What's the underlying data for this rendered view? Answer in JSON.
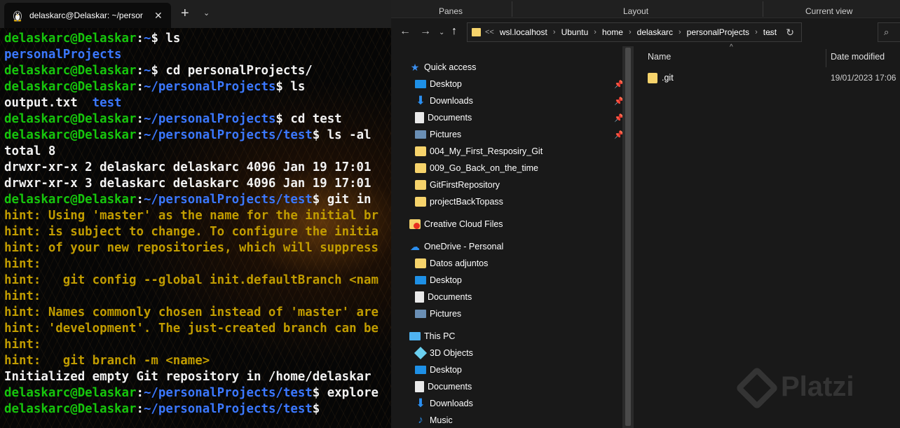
{
  "terminal": {
    "tab_title": "delaskarc@Delaskar: ~/persor",
    "icons": {
      "tab": "linux-tux-icon",
      "close": "close-icon",
      "new_tab": "plus-icon",
      "menu": "chevron-down-icon"
    },
    "lines": [
      [
        {
          "c": "pu",
          "t": "delaskarc@Delaskar"
        },
        {
          "c": "pw",
          "t": ":"
        },
        {
          "c": "pp",
          "t": "~"
        },
        {
          "c": "pw",
          "t": "$ ls"
        }
      ],
      [
        {
          "c": "dir",
          "t": "personalProjects"
        }
      ],
      [
        {
          "c": "pu",
          "t": "delaskarc@Delaskar"
        },
        {
          "c": "pw",
          "t": ":"
        },
        {
          "c": "pp",
          "t": "~"
        },
        {
          "c": "pw",
          "t": "$ cd personalProjects/"
        }
      ],
      [
        {
          "c": "pu",
          "t": "delaskarc@Delaskar"
        },
        {
          "c": "pw",
          "t": ":"
        },
        {
          "c": "pp",
          "t": "~/personalProjects"
        },
        {
          "c": "pw",
          "t": "$ ls"
        }
      ],
      [
        {
          "c": "cmd",
          "t": "output.txt  "
        },
        {
          "c": "dir",
          "t": "test"
        }
      ],
      [
        {
          "c": "pu",
          "t": "delaskarc@Delaskar"
        },
        {
          "c": "pw",
          "t": ":"
        },
        {
          "c": "pp",
          "t": "~/personalProjects"
        },
        {
          "c": "pw",
          "t": "$ cd test"
        }
      ],
      [
        {
          "c": "pu",
          "t": "delaskarc@Delaskar"
        },
        {
          "c": "pw",
          "t": ":"
        },
        {
          "c": "pp",
          "t": "~/personalProjects/test"
        },
        {
          "c": "pw",
          "t": "$ ls -al"
        }
      ],
      [
        {
          "c": "cmd",
          "t": "total 8"
        }
      ],
      [
        {
          "c": "cmd",
          "t": "drwxr-xr-x 2 delaskarc delaskarc 4096 Jan 19 17:01"
        }
      ],
      [
        {
          "c": "cmd",
          "t": "drwxr-xr-x 3 delaskarc delaskarc 4096 Jan 19 17:01"
        }
      ],
      [
        {
          "c": "pu",
          "t": "delaskarc@Delaskar"
        },
        {
          "c": "pw",
          "t": ":"
        },
        {
          "c": "pp",
          "t": "~/personalProjects/test"
        },
        {
          "c": "pw",
          "t": "$ git in"
        }
      ],
      [
        {
          "c": "hint",
          "t": "hint: Using 'master' as the name for the initial br"
        }
      ],
      [
        {
          "c": "hint",
          "t": "hint: is subject to change. To configure the initia"
        }
      ],
      [
        {
          "c": "hint",
          "t": "hint: of your new repositories, which will suppress"
        }
      ],
      [
        {
          "c": "hint",
          "t": "hint:"
        }
      ],
      [
        {
          "c": "hint",
          "t": "hint:   git config --global init.defaultBranch <nam"
        }
      ],
      [
        {
          "c": "hint",
          "t": "hint:"
        }
      ],
      [
        {
          "c": "hint",
          "t": "hint: Names commonly chosen instead of 'master' are"
        }
      ],
      [
        {
          "c": "hint",
          "t": "hint: 'development'. The just-created branch can be"
        }
      ],
      [
        {
          "c": "hint",
          "t": "hint:"
        }
      ],
      [
        {
          "c": "hint",
          "t": "hint:   git branch -m <name>"
        }
      ],
      [
        {
          "c": "cmd",
          "t": "Initialized empty Git repository in /home/delaskar"
        }
      ],
      [
        {
          "c": "pu",
          "t": "delaskarc@Delaskar"
        },
        {
          "c": "pw",
          "t": ":"
        },
        {
          "c": "pp",
          "t": "~/personalProjects/test"
        },
        {
          "c": "pw",
          "t": "$ explore"
        }
      ],
      [
        {
          "c": "pu",
          "t": "delaskarc@Delaskar"
        },
        {
          "c": "pw",
          "t": ":"
        },
        {
          "c": "pp",
          "t": "~/personalProjects/test"
        },
        {
          "c": "pw",
          "t": "$"
        }
      ]
    ],
    "colors": {
      "user": "#16c60c",
      "path": "#3b78ff",
      "hint": "#c19c00",
      "text": "#f2f2f2"
    }
  },
  "explorer": {
    "ribbon": {
      "panes": "Panes",
      "layout": "Layout",
      "current_view": "Current view"
    },
    "nav_icons": {
      "back": "arrow-left-icon",
      "forward": "arrow-right-icon",
      "recent": "chevron-down-icon",
      "up": "arrow-up-icon",
      "refresh": "refresh-icon",
      "search": "search-icon"
    },
    "address": {
      "overflow": "<<",
      "crumbs": [
        "wsl.localhost",
        "Ubuntu",
        "home",
        "delaskarc",
        "personalProjects",
        "test"
      ]
    },
    "nav": {
      "quick_access": "Quick access",
      "quick_items": [
        {
          "label": "Desktop",
          "icon": "desktop-icon",
          "pinned": true
        },
        {
          "label": "Downloads",
          "icon": "download-icon",
          "pinned": true
        },
        {
          "label": "Documents",
          "icon": "document-icon",
          "pinned": true
        },
        {
          "label": "Pictures",
          "icon": "picture-icon",
          "pinned": true
        },
        {
          "label": "004_My_First_Resposiry_Git",
          "icon": "folder-icon",
          "pinned": false
        },
        {
          "label": "009_Go_Back_on_the_time",
          "icon": "folder-icon",
          "pinned": false
        },
        {
          "label": "GitFirstRepository",
          "icon": "folder-icon",
          "pinned": false
        },
        {
          "label": "projectBackTopass",
          "icon": "folder-icon",
          "pinned": false
        }
      ],
      "creative_cloud": "Creative Cloud Files",
      "onedrive": "OneDrive - Personal",
      "onedrive_items": [
        "Datos adjuntos",
        "Desktop",
        "Documents",
        "Pictures"
      ],
      "this_pc": "This PC",
      "pc_items": [
        "3D Objects",
        "Desktop",
        "Documents",
        "Downloads",
        "Music"
      ]
    },
    "columns": {
      "name": "Name",
      "date": "Date modified"
    },
    "files": [
      {
        "name": ".git",
        "date": "19/01/2023 17:06",
        "icon": "folder-icon"
      }
    ]
  },
  "watermark": "Platzi"
}
